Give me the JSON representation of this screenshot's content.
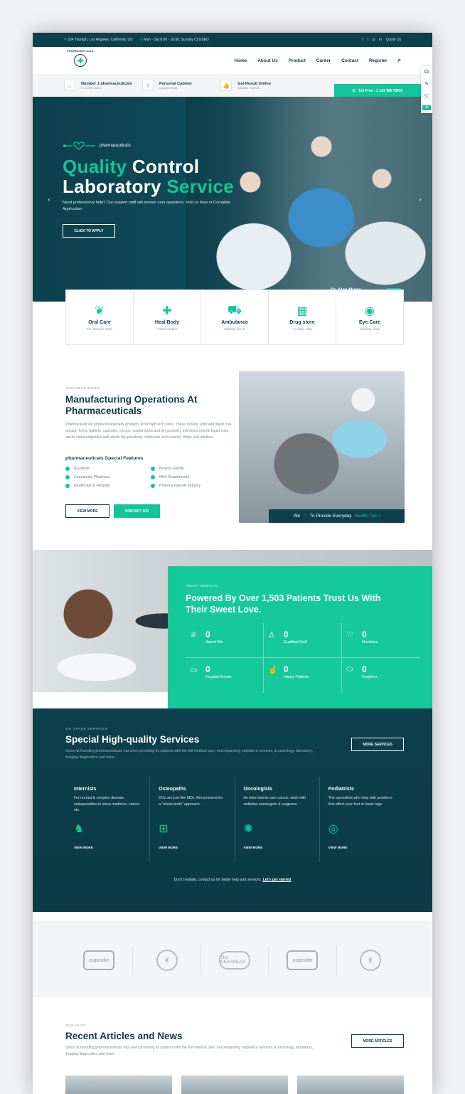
{
  "topbar": {
    "address": "234 Triumph, Los Angeles, California, US",
    "hours": "Mon - Sat 8.00 - 18.00. Sunday CLOSED",
    "quote": "Quote Us",
    "social": [
      "f",
      "t",
      "p",
      "in"
    ]
  },
  "logo": {
    "text": "PHARMACEUTICALS"
  },
  "nav": [
    "Home",
    "About Us",
    "Product",
    "Career",
    "Contact",
    "Register"
  ],
  "info": [
    {
      "title": "Number 1 pharmaceuticals",
      "sub": "In United States"
    },
    {
      "title": "Personal Cabinet",
      "sub": "Qualified Staff"
    },
    {
      "title": "Get Result Online",
      "sub": "Satisfied Patients"
    }
  ],
  "toll": "Toll Free : 1 123 456 78910",
  "hero": {
    "tag": "pharmaceuticals",
    "title_a": "Quality",
    "title_b": " Control",
    "title_c": "Laboratory ",
    "title_d": "Service",
    "subtitle": "Need professional help? Our support staff will answer your questions. Visit us Now or Complete Application",
    "button": "CLICK TO APPLY",
    "doctor": "Dr. Alex Murry",
    "contact": "Contact Us",
    "learn": "Learn More"
  },
  "features": [
    {
      "title": "Oral Care",
      "sub": "The Stronger Teeth"
    },
    {
      "title": "Heal Body",
      "sub": "A small cardtion"
    },
    {
      "title": "Ambulance",
      "sub": "Shipping Via Air"
    },
    {
      "title": "Drug store",
      "sub": "A reliable shop"
    },
    {
      "title": "Eye Care",
      "sub": "Standing vision"
    }
  ],
  "resources": {
    "small": "OUR RESOURCES",
    "title": "Manufacturing Operations At Pharmaceuticals",
    "text": "Pharmaceuticals produces specialty products at its high-tech plant. These include solid and liquid oral dosage forms (tablets, capsules, syrups, suspensions and dry powder), injections (sterile liquid vials, sterile liquid ampoules and sterile dry powders), ointments and creams, drops and inhalers.",
    "special": "pharmaceuticals Special Features",
    "list": [
      "Academic",
      "Biotech Facility",
      "Community Pharmacy",
      "NHS Departments",
      "Healthcare & Hospital",
      "Pharmaceuticals Industry"
    ],
    "btn_view": "VIEW MORE",
    "btn_contact": "CONTACT US!",
    "caption_a": "We",
    "caption_b": "To Provide Everyday",
    "caption_c": "Health-Tips !"
  },
  "about": {
    "small": "ABOUT MEDICAL",
    "title": "Powered By Over 1,503 Patients Trust Us With Their Sweet Love.",
    "stats": [
      {
        "n": "0",
        "l": "Award Win",
        "icon": "trophy-icon"
      },
      {
        "n": "0",
        "l": "Qualified Staff",
        "icon": "user-icon"
      },
      {
        "n": "0",
        "l": "Machines",
        "icon": "heart-pulse-icon"
      },
      {
        "n": "0",
        "l": "Hospital Rooms",
        "icon": "monitor-icon"
      },
      {
        "n": "0",
        "l": "Happy Patients",
        "icon": "thumbs-up-icon"
      },
      {
        "n": "0",
        "l": "Suppliers",
        "icon": "pill-icon"
      }
    ]
  },
  "services": {
    "small": "WE OFFER SERVICES",
    "title": "Special High-quality Services",
    "text": "Since its founding pharmaceuticals has been providing its patients with the full medical care, encompassing outpatient services, & neurology, laboratory, imaging diagnostics and more.",
    "button": "MORE SERVICES",
    "cards": [
      {
        "title": "Internists",
        "desc": "For normal & complex disease, subspecialties in sleep medicine, cancer etc.",
        "link": "VIEW MORE"
      },
      {
        "title": "Osteopaths",
        "desc": "DOs are just like MDs. Recommend for a \"whole body\" approach.",
        "link": "VIEW MORE"
      },
      {
        "title": "Oncologists",
        "desc": "An Internistd to cure cancer, work with radiation oncologists & surgeons.",
        "link": "VIEW MORE"
      },
      {
        "title": "Podiatrists",
        "desc": "The specialists who help with problems that affect your feet or lower legs.",
        "link": "VIEW MORE"
      }
    ],
    "foot": "Don't hesitate, contact us for better help and services.",
    "foot_link": "Let's get started"
  },
  "clients": [
    "cupcake",
    "THE LIGHTHOUSE",
    "The GEARHEAD",
    "cupcake",
    "THE LIGHTHOUSE"
  ],
  "blog": {
    "small": "OUR BLOG",
    "title": "Recent Articles and News",
    "text": "Since its founding pharmaceuticals has been providing its patients with the full medical care, encompassing outpatient services, & neurology, laboratory, imaging diagnostics and more.",
    "button": "MORE ARTICLES"
  }
}
